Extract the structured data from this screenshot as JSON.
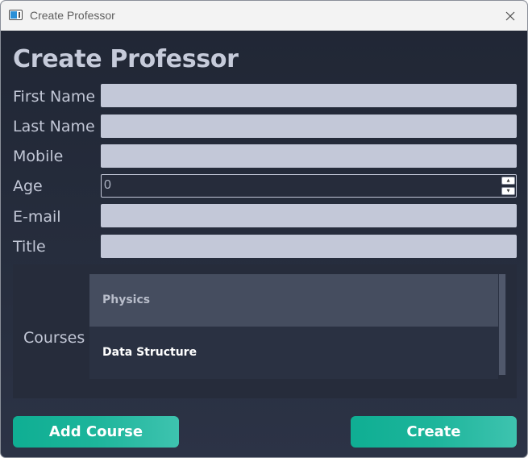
{
  "window": {
    "title": "Create Professor"
  },
  "form": {
    "heading": "Create Professor",
    "fields": {
      "first_name": {
        "label": "First Name",
        "value": ""
      },
      "last_name": {
        "label": "Last Name",
        "value": ""
      },
      "mobile": {
        "label": "Mobile",
        "value": ""
      },
      "age": {
        "label": "Age",
        "value": "0"
      },
      "email": {
        "label": "E-mail",
        "value": ""
      },
      "title": {
        "label": "Title",
        "value": ""
      }
    },
    "courses": {
      "label": "Courses",
      "items": [
        {
          "label": "Physics",
          "selected": true
        },
        {
          "label": "Data Structure",
          "selected": false
        }
      ]
    }
  },
  "actions": {
    "add_course": "Add Course",
    "create": "Create"
  },
  "colors": {
    "accent": "#1db59b",
    "background": "#262c3b",
    "input_fill": "#c3c8d8",
    "text": "#c2c7d6"
  },
  "icons": {
    "app": "window-app-icon",
    "close": "close-icon",
    "spin_up": "caret-up-icon",
    "spin_down": "caret-down-icon"
  }
}
